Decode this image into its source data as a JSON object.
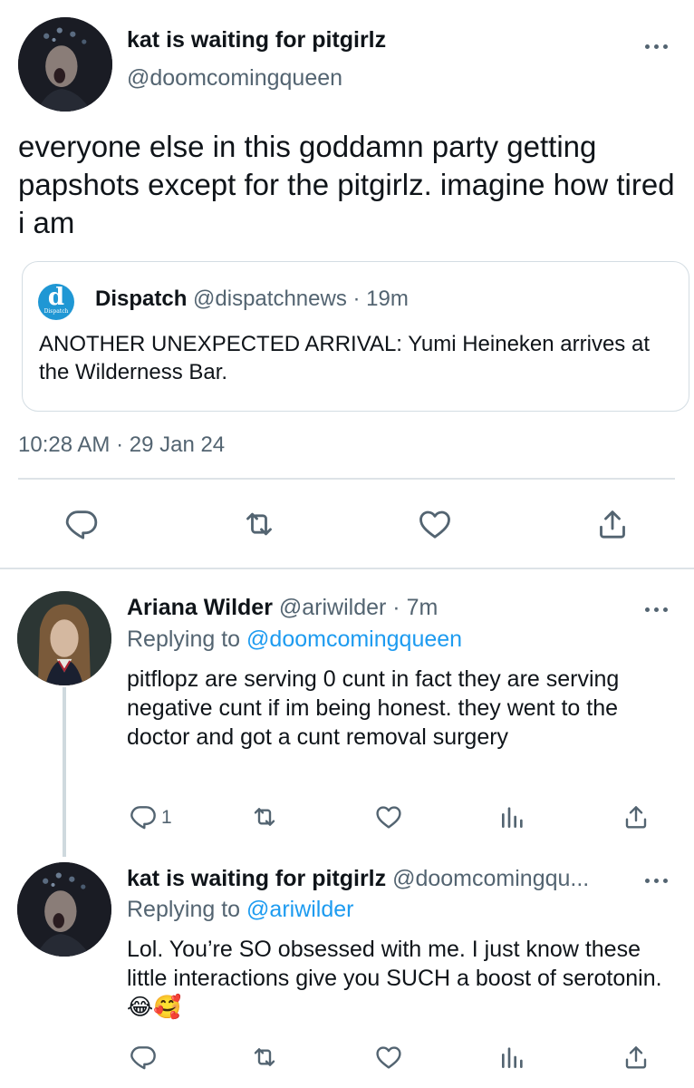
{
  "main_tweet": {
    "display_name": "kat is waiting for pitgirlz",
    "handle": "@doomcomingqueen",
    "text": "everyone else in this goddamn party  getting papshots except for the pitgirlz. imagine how tired i am",
    "timestamp": "10:28 AM · 29 Jan 24",
    "quote": {
      "logo_letter": "d",
      "logo_wordmark": "Dispatch",
      "name": "Dispatch",
      "handle": "@dispatchnews",
      "time": "19m",
      "text": "ANOTHER UNEXPECTED ARRIVAL: Yumi Heineken arrives at the Wilderness Bar."
    }
  },
  "replies": [
    {
      "display_name": "Ariana Wilder",
      "handle": "@ariwilder",
      "time": "7m",
      "replying_prefix": "Replying to",
      "replying_to": "@doomcomingqueen",
      "text": "pitflopz are serving 0 cunt in fact they are serving negative cunt if im being honest. they went to the doctor and got a cunt removal surgery",
      "reply_count": "1"
    },
    {
      "display_name": "kat is waiting for pitgirlz",
      "handle": "@doomcomingqu...",
      "replying_prefix": "Replying to",
      "replying_to": "@ariwilder",
      "text": "Lol. You’re SO obsessed with me. I just know these little interactions give you SUCH a boost of serotonin. 😂🥰"
    }
  ],
  "icons": {
    "reply": "reply-icon",
    "retweet": "retweet-icon",
    "like": "heart-icon",
    "views": "analytics-icon",
    "share": "share-icon",
    "more": "more-icon"
  },
  "colors": {
    "text": "#0f1419",
    "secondary": "#536471",
    "link": "#1d9bf0",
    "border": "#dde3e7",
    "dispatch_brand": "#1f97d4"
  }
}
